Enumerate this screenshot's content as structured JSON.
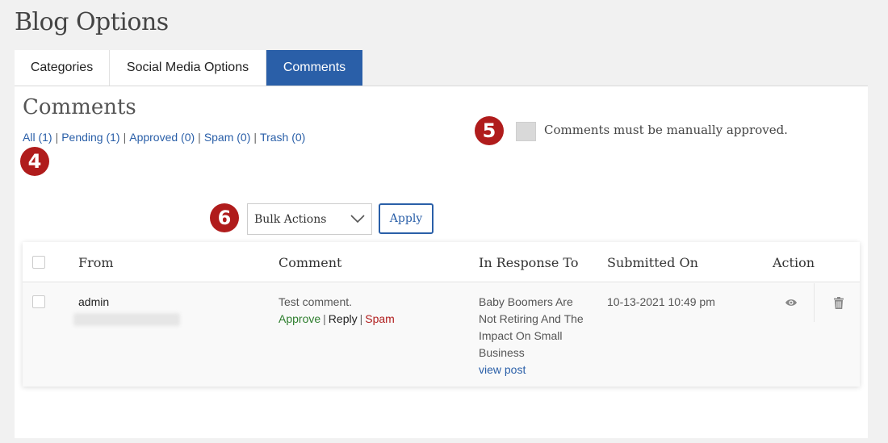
{
  "page": {
    "title": "Blog Options"
  },
  "tabs": [
    {
      "label": "Categories",
      "active": false
    },
    {
      "label": "Social Media Options",
      "active": false
    },
    {
      "label": "Comments",
      "active": true
    }
  ],
  "section": {
    "title": "Comments"
  },
  "filters": [
    {
      "label": "All (1)"
    },
    {
      "label": "Pending (1)"
    },
    {
      "label": "Approved (0)"
    },
    {
      "label": "Spam (0)"
    },
    {
      "label": "Trash (0)"
    }
  ],
  "badges": {
    "b4": "4",
    "b5": "5",
    "b6": "6"
  },
  "settings": {
    "manual_approval_label": "Comments must be manually approved.",
    "manual_approval_checked": false
  },
  "bulk": {
    "selected": "Bulk Actions",
    "apply_label": "Apply"
  },
  "table": {
    "headers": {
      "from": "From",
      "comment": "Comment",
      "response": "In Response To",
      "submitted": "Submitted On",
      "action": "Action"
    },
    "rows": [
      {
        "from": "admin",
        "comment": "Test comment.",
        "actions": {
          "approve": "Approve",
          "reply": "Reply",
          "spam": "Spam"
        },
        "response": "Baby Boomers Are Not Retiring And The Impact On Small Business",
        "view_post": "view post",
        "submitted": "10-13-2021 10:49 pm"
      }
    ]
  },
  "icons": {
    "view": "eye-icon",
    "delete": "trash-icon",
    "select": "chevron-down-icon"
  },
  "colors": {
    "accent": "#2a5fa8",
    "badge": "#b01c1c",
    "approve": "#2d7d2d",
    "spam": "#b01c1c"
  }
}
